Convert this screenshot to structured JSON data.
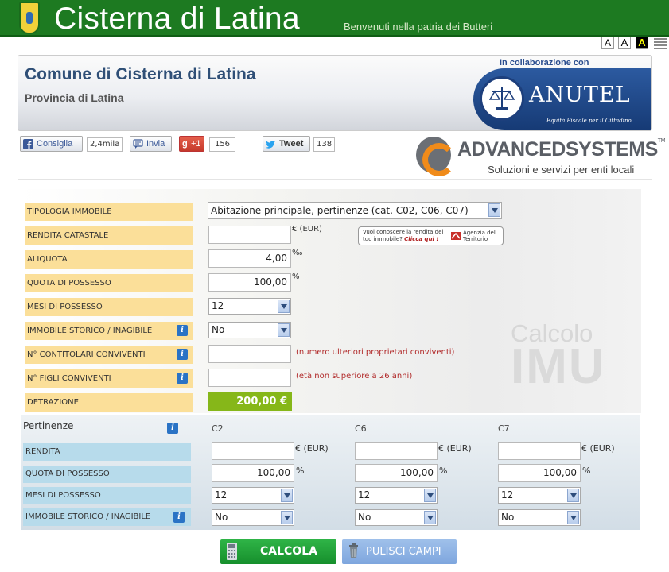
{
  "header": {
    "site_title": "Cisterna di Latina",
    "site_subtitle": "Benvenuti nella patria dei Butteri",
    "font_tools": [
      "A",
      "A",
      "A"
    ],
    "colors": {
      "green": "#1d7a21"
    }
  },
  "banner": {
    "title": "Comune di Cisterna di Latina",
    "subtitle": "Provincia di Latina",
    "collaboration": "In collaborazione con",
    "partner_name": "ANUTEL",
    "partner_tagline": "Equità Fiscale per il Cittadino"
  },
  "social": {
    "fb_label": "Consiglia",
    "fb_count": "2,4mila",
    "share_label": "Invia",
    "gplus_label": "+1",
    "gplus_count": "156",
    "tweet_label": "Tweet",
    "tweet_count": "138"
  },
  "sponsor": {
    "name": "ADVANCEDSYSTEMS",
    "tm": "TM",
    "tagline": "Soluzioni e servizi per enti locali"
  },
  "form": {
    "tipologia": {
      "label": "TIPOLOGIA IMMOBILE",
      "value": "Abitazione principale, pertinenze (cat. C02, C06, C07)"
    },
    "rendita": {
      "label": "RENDITA CATASTALE",
      "value": "",
      "unit": "€ (EUR)"
    },
    "agenzia": {
      "line1": "Vuoi conoscere la rendita del",
      "line2": "tuo immobile?",
      "link": "Clicca qui !",
      "logo_line1": "Agenzia del",
      "logo_line2": "Territorio"
    },
    "aliquota": {
      "label": "ALIQUOTA",
      "value": "4,00",
      "unit": "‰"
    },
    "quota": {
      "label": "QUOTA DI POSSESSO",
      "value": "100,00",
      "unit": "%"
    },
    "mesi": {
      "label": "MESI DI POSSESSO",
      "value": "12"
    },
    "storico": {
      "label": "IMMOBILE STORICO / INAGIBILE",
      "value": "No"
    },
    "contitolari": {
      "label": "N° CONTITOLARI CONVIVENTI",
      "value": "",
      "note": "(numero ulteriori proprietari conviventi)"
    },
    "figli": {
      "label": "N° FIGLI CONVIVENTI",
      "value": "",
      "note": "(età non superiore a 26 anni)"
    },
    "detrazione": {
      "label": "DETRAZIONE",
      "value": "200,00 €"
    },
    "watermark_1": "Calcolo",
    "watermark_2": "IMU"
  },
  "pertinenze": {
    "title": "Pertinenze",
    "columns": [
      "C2",
      "C6",
      "C7"
    ],
    "rows": {
      "rendita": {
        "label": "RENDITA",
        "values": [
          "",
          "",
          ""
        ],
        "unit": "€ (EUR)"
      },
      "quota": {
        "label": "QUOTA DI POSSESSO",
        "values": [
          "100,00",
          "100,00",
          "100,00"
        ],
        "unit": "%"
      },
      "mesi": {
        "label": "MESI DI POSSESSO",
        "values": [
          "12",
          "12",
          "12"
        ]
      },
      "storico": {
        "label": "IMMOBILE STORICO / INAGIBILE",
        "values": [
          "No",
          "No",
          "No"
        ]
      }
    }
  },
  "actions": {
    "calcola": "CALCOLA",
    "pulisci": "PULISCI CAMPI"
  },
  "icons": {
    "info": "i"
  }
}
